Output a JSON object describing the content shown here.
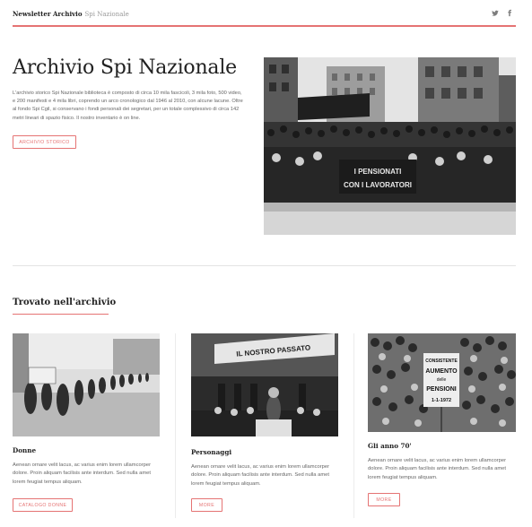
{
  "header": {
    "brand_strong": "Newsletter Archivio",
    "brand_light": "Spi Nazionale",
    "social": [
      "twitter-icon",
      "facebook-icon"
    ]
  },
  "hero": {
    "title": "Archivio Spi Nazionale",
    "text": "L'archivio storico Spi Nazionale biblioteca è composto di circa 10 mila fascicoli, 3 mila foto, 500 video, e 200 manifesti e 4 mila libri, coprendo un arco cronologico dal 1946 al 2010, con alcune lacune. Oltre al fondo Spi Cgil, si conservano i fondi personali dei segretari, per un totale complessivo di circa 142 metri lineari di spazio fisico. Il nostro inventario è on line.",
    "button": "Archivio storico",
    "photo_signs": [
      "I PENSIONATI",
      "CON I LAVORATORI"
    ]
  },
  "section": {
    "title": "Trovato nell'archivio"
  },
  "cards": [
    {
      "title": "Donne",
      "text": "Aenean ornare velit lacus, ac varius enim lorem ullamcorper dolore. Proin aliquam facilisis ante interdum. Sed nulla amet lorem feugiat tempus aliquam.",
      "button": "Catalogo donne"
    },
    {
      "title": "Personaggi",
      "text": "Aenean ornare velit lacus, ac varius enim lorem ullamcorper dolore. Proin aliquam facilisis ante interdum. Sed nulla amet lorem feugiat tempus aliquam.",
      "button": "More",
      "photo_banner": "IL NOSTRO PASSATO"
    },
    {
      "title": "Gli anno 70'",
      "text": "Aenean ornare velit lacus, ac varius enim lorem ullamcorper dolore. Proin aliquam facilisis ante interdum. Sed nulla amet lorem feugiat tempus aliquam.",
      "button": "More",
      "photo_sign": [
        "CONSISTENTE",
        "AUMENTO",
        "delle",
        "PENSIONI",
        "1-1-1972"
      ]
    }
  ]
}
